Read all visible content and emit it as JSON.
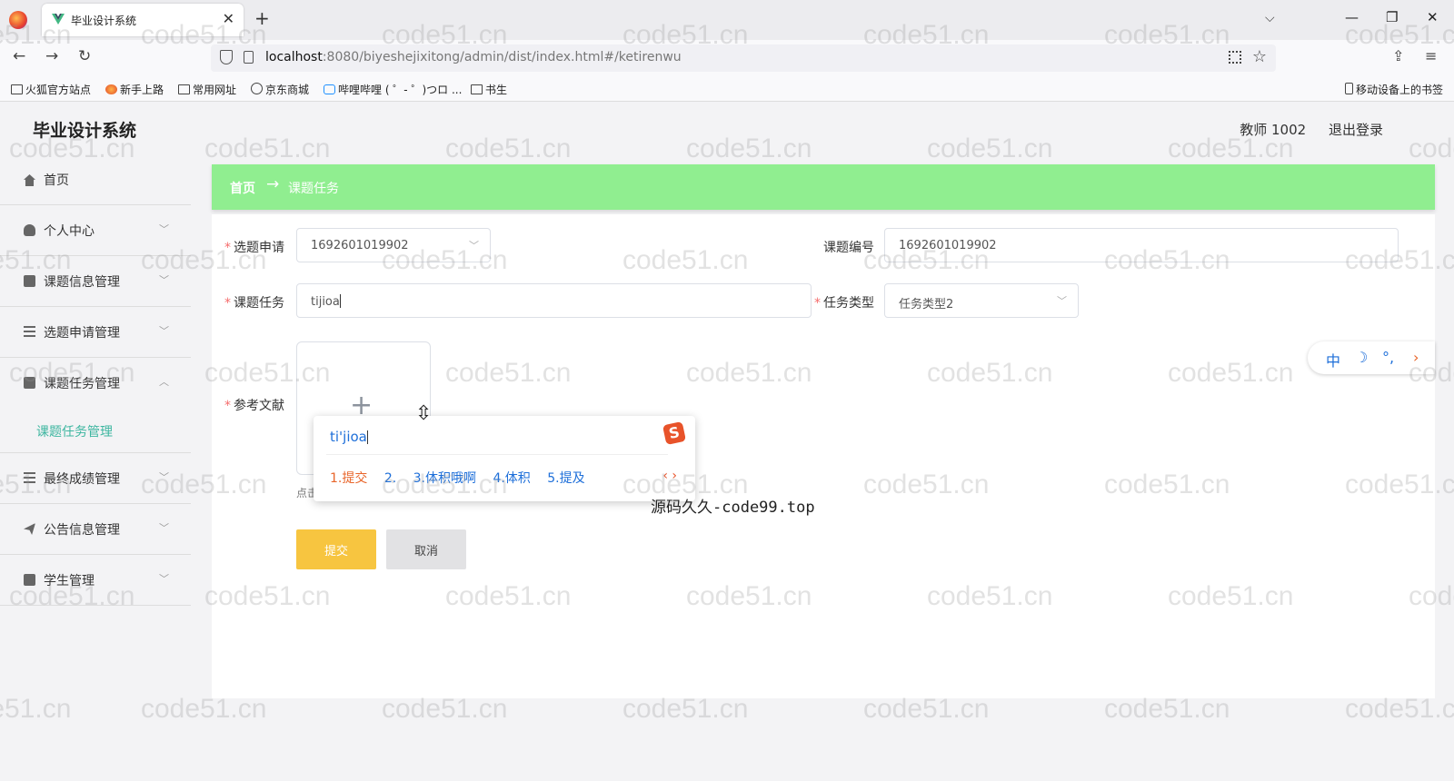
{
  "browser": {
    "tab_title": "毕业设计系统",
    "new_tab": "+",
    "close": "✕",
    "url_host": "localhost",
    "url_rest": ":8080/biyeshejixitong/admin/dist/index.html#/ketirenwu",
    "bookmarks": [
      "火狐官方站点",
      "新手上路",
      "常用网址",
      "京东商城",
      "哔哩哔哩 ( ゜- ゜)つロ ...",
      "书生"
    ],
    "mobile_bookmarks": "移动设备上的书签"
  },
  "app": {
    "title": "毕业设计系统",
    "user": "教师 1002",
    "logout": "退出登录"
  },
  "sidebar": {
    "items": [
      {
        "label": "首页",
        "icon": "home-icon"
      },
      {
        "label": "个人中心",
        "icon": "user-icon"
      },
      {
        "label": "课题信息管理",
        "icon": "briefcase-icon"
      },
      {
        "label": "选题申请管理",
        "icon": "list-icon"
      },
      {
        "label": "课题任务管理",
        "icon": "calendar-icon"
      },
      {
        "label": "最终成绩管理",
        "icon": "list-icon"
      },
      {
        "label": "公告信息管理",
        "icon": "send-icon"
      },
      {
        "label": "学生管理",
        "icon": "monitor-icon"
      }
    ],
    "sub_item": "课题任务管理"
  },
  "breadcrumb": {
    "home": "首页",
    "arrow": "→",
    "current": "课题任务"
  },
  "form": {
    "xuanti_label": "选题申请",
    "xuanti_value": "1692601019902",
    "bianhao_label": "课题编号",
    "bianhao_value": "1692601019902",
    "renwu_label": "课题任务",
    "renwu_value": "tijioa",
    "leixing_label": "任务类型",
    "leixing_value": "任务类型2",
    "wenxian_label": "参考文献",
    "upload_hint": "点击上传参考文献",
    "submit": "提交",
    "cancel": "取消"
  },
  "ime": {
    "pinyin": "ti'jioa",
    "candidates": [
      "1.提交",
      "2.",
      "3.体积哦啊",
      "4.体积",
      "5.提及"
    ],
    "bar": {
      "mode": "中",
      "moon": "☽",
      "dots": "°,",
      "more": "›"
    }
  },
  "banner": "源码久久-code99.top",
  "watermark": "code51.cn",
  "colors": {
    "breadcrumb_bg": "#90ee90",
    "submit_bg": "#f7c540",
    "active_menu": "#3db6a0",
    "ime_blue": "#1e6fd9"
  }
}
